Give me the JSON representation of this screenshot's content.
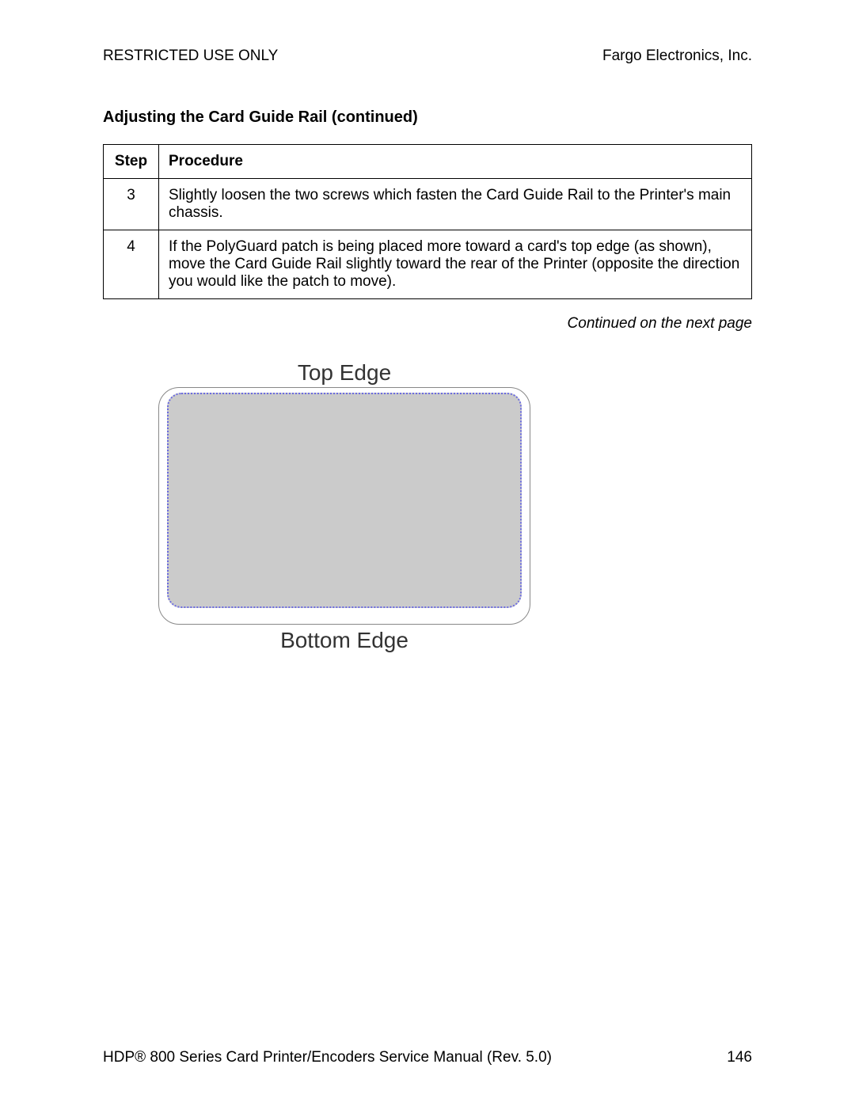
{
  "header": {
    "left": "RESTRICTED USE ONLY",
    "right": "Fargo Electronics, Inc."
  },
  "section_title": "Adjusting the Card Guide Rail (continued)",
  "table": {
    "head_step": "Step",
    "head_procedure": "Procedure",
    "rows": [
      {
        "step": "3",
        "procedure": "Slightly loosen the two screws which fasten the Card Guide Rail to the Printer's main chassis."
      },
      {
        "step": "4",
        "procedure": "If the PolyGuard patch is being placed more toward a card's top edge (as shown), move the Card Guide Rail slightly toward the rear of the Printer (opposite the direction you would like the patch to move)."
      }
    ]
  },
  "continued_text": "Continued on the next page",
  "diagram": {
    "top_label": "Top Edge",
    "bottom_label": "Bottom Edge"
  },
  "footer": {
    "left": "HDP® 800 Series Card Printer/Encoders Service Manual (Rev. 5.0)",
    "page_num": "146"
  }
}
